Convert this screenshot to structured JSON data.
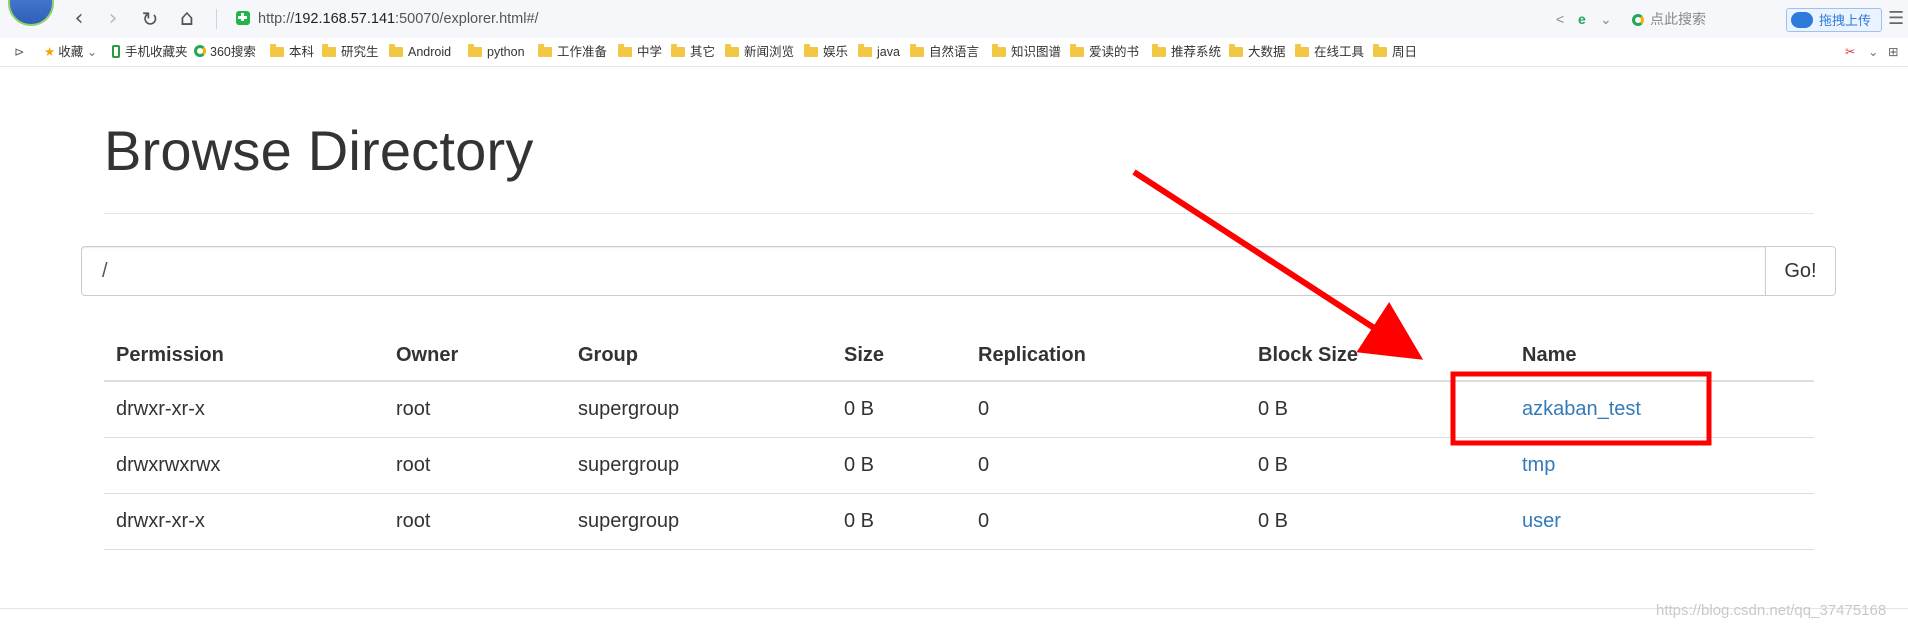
{
  "browser": {
    "nav": {
      "back": "‹",
      "forward": "›",
      "reload": "↻",
      "home": "⌂"
    },
    "address": {
      "scheme": "http://",
      "host": "192.168.57.141",
      "rest": ":50070/explorer.html#/"
    },
    "search_placeholder": "点此搜索",
    "upload_label": "拖拽上传",
    "bookmarks": [
      {
        "label": "收藏",
        "icon": "star-icon",
        "suffix": " ⌄"
      },
      {
        "label": "手机收藏夹",
        "icon": "phone-icon"
      },
      {
        "label": "360搜索",
        "icon": "360-icon"
      },
      {
        "label": "本科",
        "icon": "folder-icon"
      },
      {
        "label": "研究生",
        "icon": "folder-icon"
      },
      {
        "label": "Android",
        "icon": "folder-icon"
      },
      {
        "label": "python",
        "icon": "folder-icon"
      },
      {
        "label": "工作准备",
        "icon": "folder-icon"
      },
      {
        "label": "中学",
        "icon": "folder-icon"
      },
      {
        "label": "其它",
        "icon": "folder-icon"
      },
      {
        "label": "新闻浏览",
        "icon": "folder-icon"
      },
      {
        "label": "娱乐",
        "icon": "folder-icon"
      },
      {
        "label": "java",
        "icon": "folder-icon"
      },
      {
        "label": "自然语言",
        "icon": "folder-icon"
      },
      {
        "label": "知识图谱",
        "icon": "folder-icon"
      },
      {
        "label": "爱读的书",
        "icon": "folder-icon"
      },
      {
        "label": "推荐系统",
        "icon": "folder-icon"
      },
      {
        "label": "大数据",
        "icon": "folder-icon"
      },
      {
        "label": "在线工具",
        "icon": "folder-icon"
      },
      {
        "label": "周日",
        "icon": "folder-icon"
      }
    ]
  },
  "page": {
    "title": "Browse Directory",
    "path_value": "/",
    "go_label": "Go!",
    "table": {
      "headers": [
        "Permission",
        "Owner",
        "Group",
        "Size",
        "Replication",
        "Block Size",
        "Name"
      ],
      "rows": [
        [
          "drwxr-xr-x",
          "root",
          "supergroup",
          "0 B",
          "0",
          "0 B",
          "azkaban_test"
        ],
        [
          "drwxrwxrwx",
          "root",
          "supergroup",
          "0 B",
          "0",
          "0 B",
          "tmp"
        ],
        [
          "drwxr-xr-x",
          "root",
          "supergroup",
          "0 B",
          "0",
          "0 B",
          "user"
        ]
      ]
    }
  },
  "watermark": "https://blog.csdn.net/qq_37475168",
  "colors": {
    "link": "#337ab7",
    "annotation": "#ff0000"
  }
}
